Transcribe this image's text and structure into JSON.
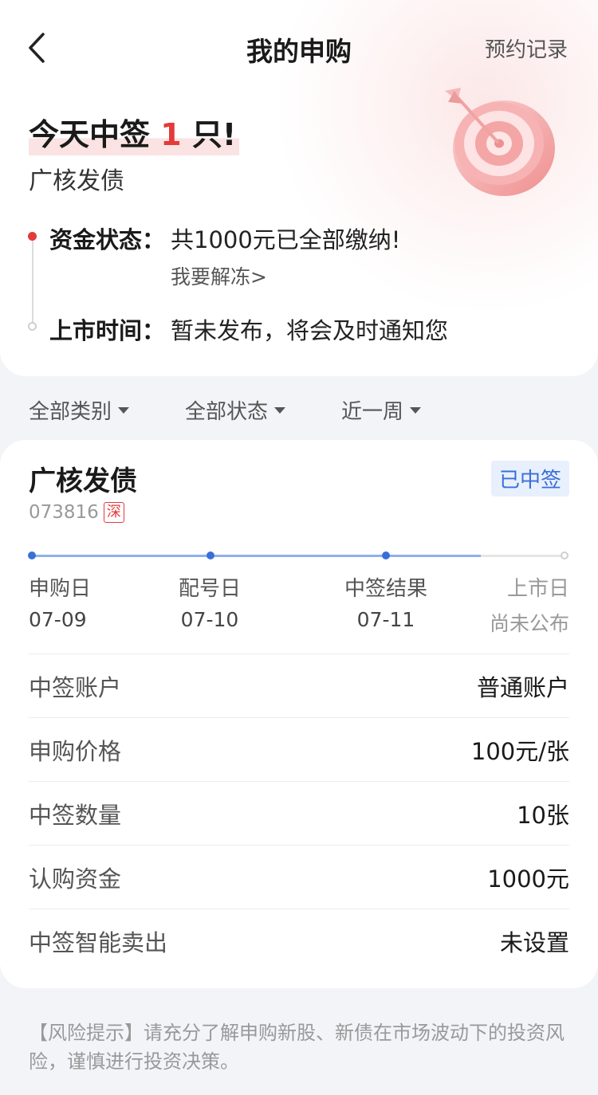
{
  "nav": {
    "title": "我的申购",
    "right_link": "预约记录"
  },
  "summary": {
    "headline_prefix": "今天中签 ",
    "headline_count": "1",
    "headline_suffix": " 只!",
    "name": "广核发债",
    "fund_status_label": "资金状态：",
    "fund_status_value": "共1000元已全部缴纳!",
    "unfreeze_link": "我要解冻>",
    "listing_label": "上市时间：",
    "listing_value": "暂未发布，将会及时通知您"
  },
  "filters": [
    {
      "label": "全部类别"
    },
    {
      "label": "全部状态"
    },
    {
      "label": "近一周"
    }
  ],
  "card": {
    "name": "广核发债",
    "status_badge": "已中签",
    "code": "073816",
    "market_badge": "深",
    "progress_fraction": 0.84,
    "steps": [
      {
        "name": "申购日",
        "date": "07-09"
      },
      {
        "name": "配号日",
        "date": "07-10"
      },
      {
        "name": "中签结果",
        "date": "07-11"
      },
      {
        "name": "上市日",
        "date": "尚未公布"
      }
    ],
    "details": [
      {
        "label": "中签账户",
        "value": "普通账户"
      },
      {
        "label": "申购价格",
        "value": "100元/张"
      },
      {
        "label": "中签数量",
        "value": "10张"
      },
      {
        "label": "认购资金",
        "value": "1000元"
      },
      {
        "label": "中签智能卖出",
        "value": "未设置"
      }
    ]
  },
  "risk_notice": "【风险提示】请充分了解申购新股、新债在市场波动下的投资风险，谨慎进行投资决策。",
  "colors": {
    "accent_red": "#e53a3a",
    "accent_blue": "#3a6fd8"
  }
}
